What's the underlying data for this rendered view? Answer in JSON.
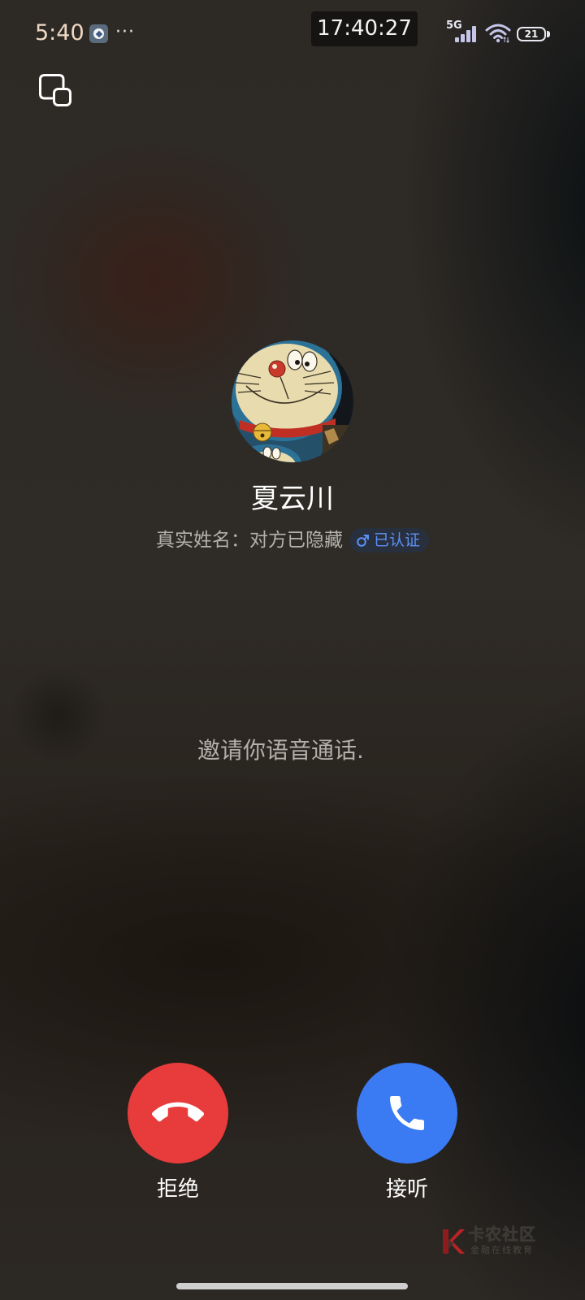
{
  "status_bar": {
    "time": "5:40",
    "more": "···",
    "clock": "17:40:27",
    "network": "5G",
    "battery": "21"
  },
  "caller": {
    "name": "夏云川",
    "real_name_label": "真实姓名：对方已隐藏",
    "verified_label": "已认证"
  },
  "call_status": "邀请你语音通话.",
  "actions": {
    "decline_label": "拒绝",
    "accept_label": "接听"
  },
  "watermark": {
    "brand": "卡农社区",
    "tagline": "金融在线教育"
  },
  "colors": {
    "decline": "#e83c3c",
    "accept": "#3a7af3",
    "verified": "#5b90f5",
    "status_time": "#efd9c3"
  },
  "icons": {
    "app_notification": "app-notification-icon",
    "signal": "signal-icon",
    "wifi": "wifi-icon",
    "battery": "battery-icon",
    "float_window": "float-window-icon",
    "gender": "male-icon",
    "decline": "phone-hangup-icon",
    "accept": "phone-icon",
    "watermark_logo": "kanong-logo-icon"
  }
}
